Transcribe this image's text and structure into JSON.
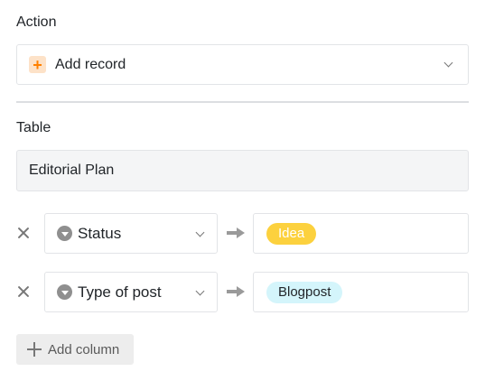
{
  "action": {
    "label": "Action",
    "selected": "Add record",
    "icon": "plus-icon",
    "icon_color": "#ff8000"
  },
  "table": {
    "label": "Table",
    "value": "Editorial Plan"
  },
  "rows": [
    {
      "column": "Status",
      "value": "Idea",
      "value_bg": "#fcd13e",
      "value_color": "#ffffff"
    },
    {
      "column": "Type of post",
      "value": "Blogpost",
      "value_bg": "#d4f5fb",
      "value_color": "#212529"
    }
  ],
  "add_column_label": "Add column"
}
